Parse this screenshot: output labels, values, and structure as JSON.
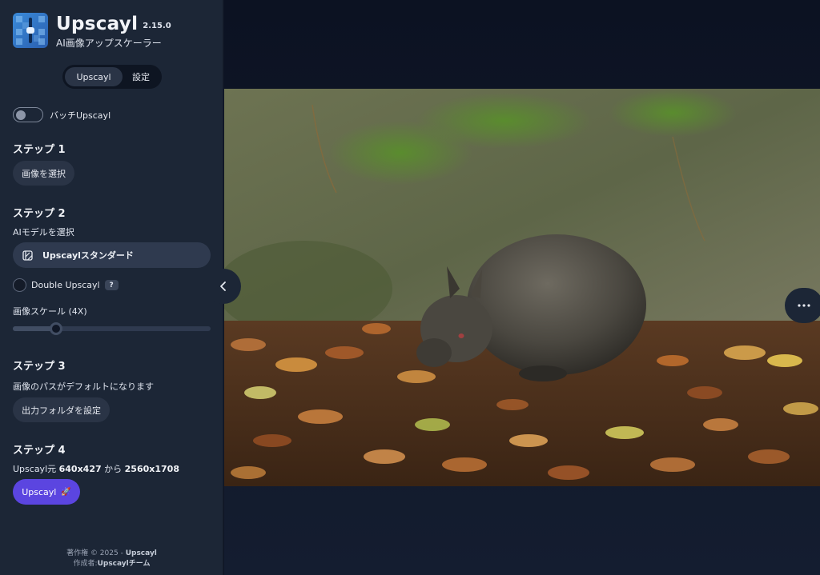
{
  "app": {
    "name": "Upscayl",
    "version": "2.15.0",
    "subtitle": "AI画像アップスケーラー"
  },
  "tabs": [
    {
      "label": "Upscayl",
      "active": true
    },
    {
      "label": "設定",
      "active": false
    }
  ],
  "batch": {
    "label": "バッチUpscayl",
    "enabled": false
  },
  "step1": {
    "title": "ステップ 1",
    "button": "画像を選択"
  },
  "step2": {
    "title": "ステップ 2",
    "model_label": "AIモデルを選択",
    "model_value": "Upscaylスタンダード",
    "double_label": "Double Upscayl",
    "double_checked": false,
    "help": "?",
    "scale_label": "画像スケール (4X)",
    "scale_fraction": 0.22
  },
  "step3": {
    "title": "ステップ 3",
    "info": "画像のパスがデフォルトになります",
    "button": "出力フォルダを設定"
  },
  "step4": {
    "title": "ステップ 4",
    "prefix": "Upscayl元",
    "from_size": "640x427",
    "connector": "から",
    "to_size": "2560x1708",
    "button": "Upscayl"
  },
  "footer": {
    "line1_prefix": "著作権 © 2025 -",
    "line1_name": "Upscayl",
    "line2_prefix": "作成者:",
    "line2_name": "Upscaylチーム"
  },
  "icons": {
    "collapse": "chevron-left-icon",
    "more": "more-horizontal-icon",
    "model": "model-swap-icon",
    "run": "rocket-icon"
  },
  "colors": {
    "sidebar_bg": "#1c2636",
    "main_bg": "#0c1222",
    "accent": "#5b45e0",
    "button_bg": "#2a3446"
  }
}
